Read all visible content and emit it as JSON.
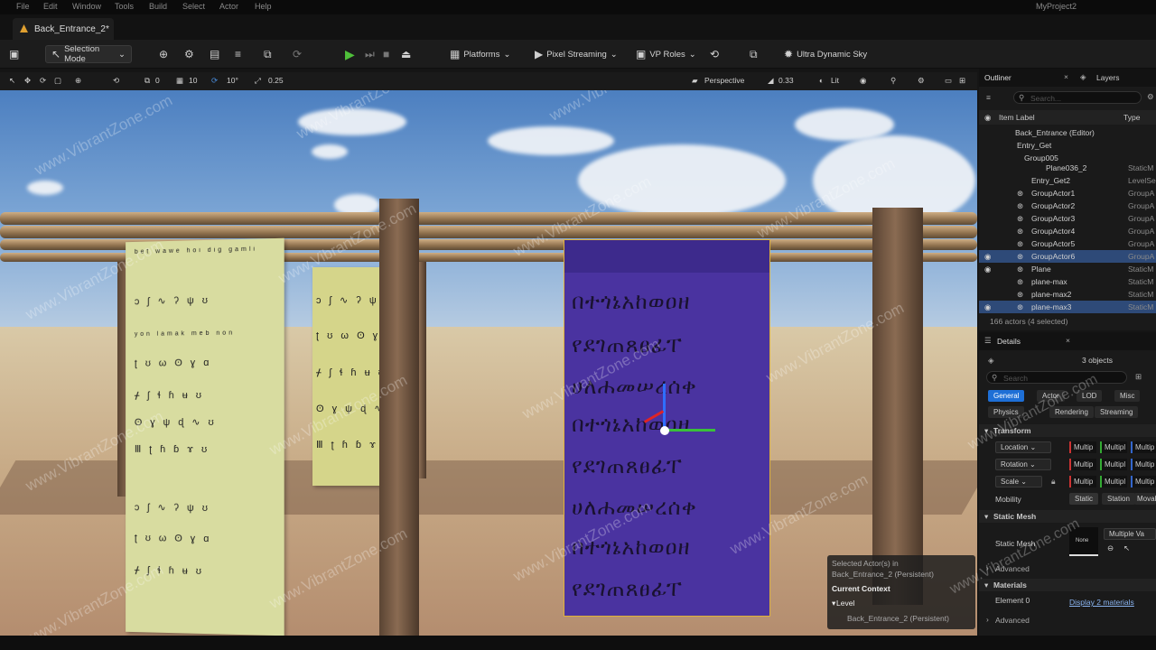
{
  "menubar": {
    "items": [
      "File",
      "Edit",
      "Window",
      "Tools",
      "Build",
      "Select",
      "Actor",
      "Help"
    ],
    "project": "MyProject2"
  },
  "tab": {
    "title": "Back_Entrance_2*"
  },
  "toolbar": {
    "selection_mode": "Selection Mode",
    "platforms": "Platforms",
    "pixel_streaming": "Pixel Streaming",
    "vp_roles": "VP Roles",
    "sky": "Ultra Dynamic Sky"
  },
  "viewport_toolbar": {
    "translate_snap": "10",
    "rotate_snap": "10°",
    "scale_snap": "0.25",
    "grid_val": "0",
    "view": "Perspective",
    "fov": "0.33",
    "lit": "Lit"
  },
  "scene": {
    "purple_lines": [
      "በተጎኔአከወዐዘ",
      "የደገጠጸፀፊፐ",
      "ሀለሐመሠረሰቀ",
      "በተጎኔአከወዐዘ",
      "የደገጠጸፀፊፐ",
      "ሀለሐመሠረሰቀ",
      "በተጎኔአከወዐዘ",
      "የደገጠጸፀፊፐ"
    ],
    "green_rows": [
      "bet wawe hoi dig gamli",
      "ɔ ʃ ∿ ʔ ψ ʊ",
      "yon lamak meb non",
      "ʈ ʊ ω ʘ ɣ ɑ",
      "ᚋ ʃ ɬ ɦ ʉ ʊ",
      "ʘ ɣ ψ ɖ ∿ ʊ",
      "Ⅲ ʈ ɦ ɓ ɤ ʊ",
      "ɔ ʃ ∿ ʔ ψ ʊ",
      "ʈ ʊ ω ʘ ɣ ɑ",
      "ᚋ ʃ ɬ ɦ ʉ ʊ"
    ],
    "watermark": "www.VibrantZone.com"
  },
  "context": {
    "selected": "Selected Actor(s) in",
    "selected_level": "Back_Entrance_2 (Persistent)",
    "current_context": "Current Context",
    "level": "Level",
    "level_value": "Back_Entrance_2 (Persistent)"
  },
  "outliner": {
    "tab_outliner": "Outliner",
    "tab_layers": "Layers",
    "search_placeholder": "Search...",
    "col_label": "Item Label",
    "col_type": "Type",
    "rows": [
      {
        "label": "Back_Entrance (Editor)",
        "type": ""
      },
      {
        "label": "Entry_Get",
        "type": ""
      },
      {
        "label": "Group005",
        "type": ""
      },
      {
        "label": "Plane036_2",
        "type": "StaticM"
      },
      {
        "label": "Entry_Get2",
        "type": "LevelSe"
      },
      {
        "label": "GroupActor1",
        "type": "GroupA"
      },
      {
        "label": "GroupActor2",
        "type": "GroupA"
      },
      {
        "label": "GroupActor3",
        "type": "GroupA"
      },
      {
        "label": "GroupActor4",
        "type": "GroupA"
      },
      {
        "label": "GroupActor5",
        "type": "GroupA"
      },
      {
        "label": "GroupActor6",
        "type": "GroupA"
      },
      {
        "label": "Plane",
        "type": "StaticM"
      },
      {
        "label": "plane-max",
        "type": "StaticM"
      },
      {
        "label": "plane-max2",
        "type": "StaticM"
      },
      {
        "label": "plane-max3",
        "type": "StaticM"
      }
    ],
    "count": "166 actors (4 selected)"
  },
  "details": {
    "title": "Details",
    "objects": "3 objects",
    "search_placeholder": "Search",
    "filters": [
      "General",
      "Actor",
      "LOD",
      "Misc"
    ],
    "filters2": [
      "Physics",
      "Rendering",
      "Streaming"
    ],
    "transform": "Transform",
    "location": "Location",
    "rotation": "Rotation",
    "scale": "Scale",
    "multiple": "Multip",
    "multiple2": "Multipl",
    "mobility": "Mobility",
    "mobility_opts": [
      "Static",
      "Station",
      "Movab"
    ],
    "static_mesh_header": "Static Mesh",
    "static_mesh_label": "Static Mesh",
    "none": "None",
    "multiple_values": "Multiple Va",
    "advanced": "Advanced",
    "materials": "Materials",
    "element0": "Element 0",
    "display_materials": "Display 2 materials",
    "advanced2": "Advanced"
  }
}
